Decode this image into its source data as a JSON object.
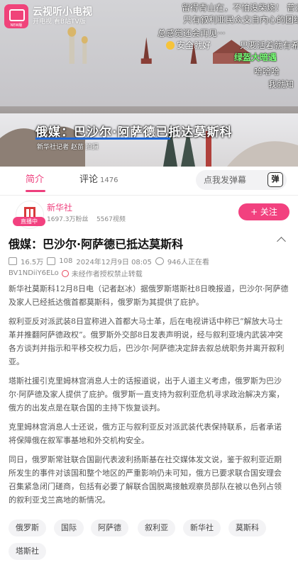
{
  "app": {
    "name": "云视听小电视",
    "slogan": "开电视 看B站TV版",
    "logo_sub": "NEW版"
  },
  "video": {
    "caption": "俄媒：巴沙尔·阿萨德已抵达莫斯科",
    "reporter": "新华社记者 赵苗 拍摄",
    "danmaku": [
      "留得青山在，不怕没柴烧！ 普京",
      "只有叙利亚民众支自内心的团结",
      "总感觉还会再见···",
      "安全就好",
      "只要活着就有希",
      "绿盔大暗遇",
      "哈哈哈",
      "我就知"
    ]
  },
  "tabs": {
    "intro": "简介",
    "comments": "评论",
    "comment_count": "1476",
    "danmu_placeholder": "点我发弹幕",
    "danmu_toggle": "弹"
  },
  "channel": {
    "name": "新华社",
    "live_badge": "直播中",
    "followers": "1697.3万粉丝",
    "videos": "5567视频",
    "follow_label": "+ 关注"
  },
  "article": {
    "title": "俄媒：巴沙尔·阿萨德已抵达莫斯科",
    "views": "16.5万",
    "danmaku_count": "108",
    "date": "2024年12月9日 08:05",
    "watching": "946人正在看",
    "bvid": "BV1NDiiY6ELo",
    "notice": "未经作者授权禁止转载",
    "paragraphs": [
      "新华社莫斯科12月8日电（记者赵冰）据俄罗斯塔斯社8日晚报道，巴沙尔·阿萨德及家人已经抵达俄首都莫斯科，俄罗斯为其提供了庇护。",
      "叙利亚反对派武装8日宣称进入首都大马士革，后在电视讲话中称已“解放大马士革并推翻阿萨德政权”。俄罗斯外交部8日发表声明说，经与叙利亚境内武装冲突各方谈判并指示和平移交权力后，巴沙尔·阿萨德决定辞去叙总统职务并离开叙利亚。",
      "塔斯社援引克里姆林宫消息人士的话报道说，出于人道主义考虑，俄罗斯为巴沙尔·阿萨德及家人提供了庇护。俄罗斯一直支持为叙利亚危机寻求政治解决方案，俄方的出发点是在联合国的主持下恢复谈判。",
      "克里姆林宫消息人士还说，俄方正与叙利亚反对派武装代表保持联系，后者承诺将保障俄在叙军事基地和外交机构安全。",
      "同日，俄罗斯常驻联合国副代表波利扬斯基在社交媒体发文说，鉴于叙利亚近期所发生的事件对该国和整个地区的严重影响仍未可知，俄方已要求联合国安理会召集紧急闭门磋商，包括有必要了解联合国脱离接触观察员部队在被以色列占领的叙利亚戈兰高地的新情况。"
    ]
  },
  "tags": [
    "俄罗斯",
    "国际",
    "阿萨德",
    "叙利亚",
    "新华社",
    "莫斯科",
    "塔斯社"
  ],
  "colors": {
    "accent": "#ee3f7d",
    "follow_bg": "#f2417f",
    "danmu_green": "#7dff7a",
    "caption_bar": "#1d66d6"
  }
}
